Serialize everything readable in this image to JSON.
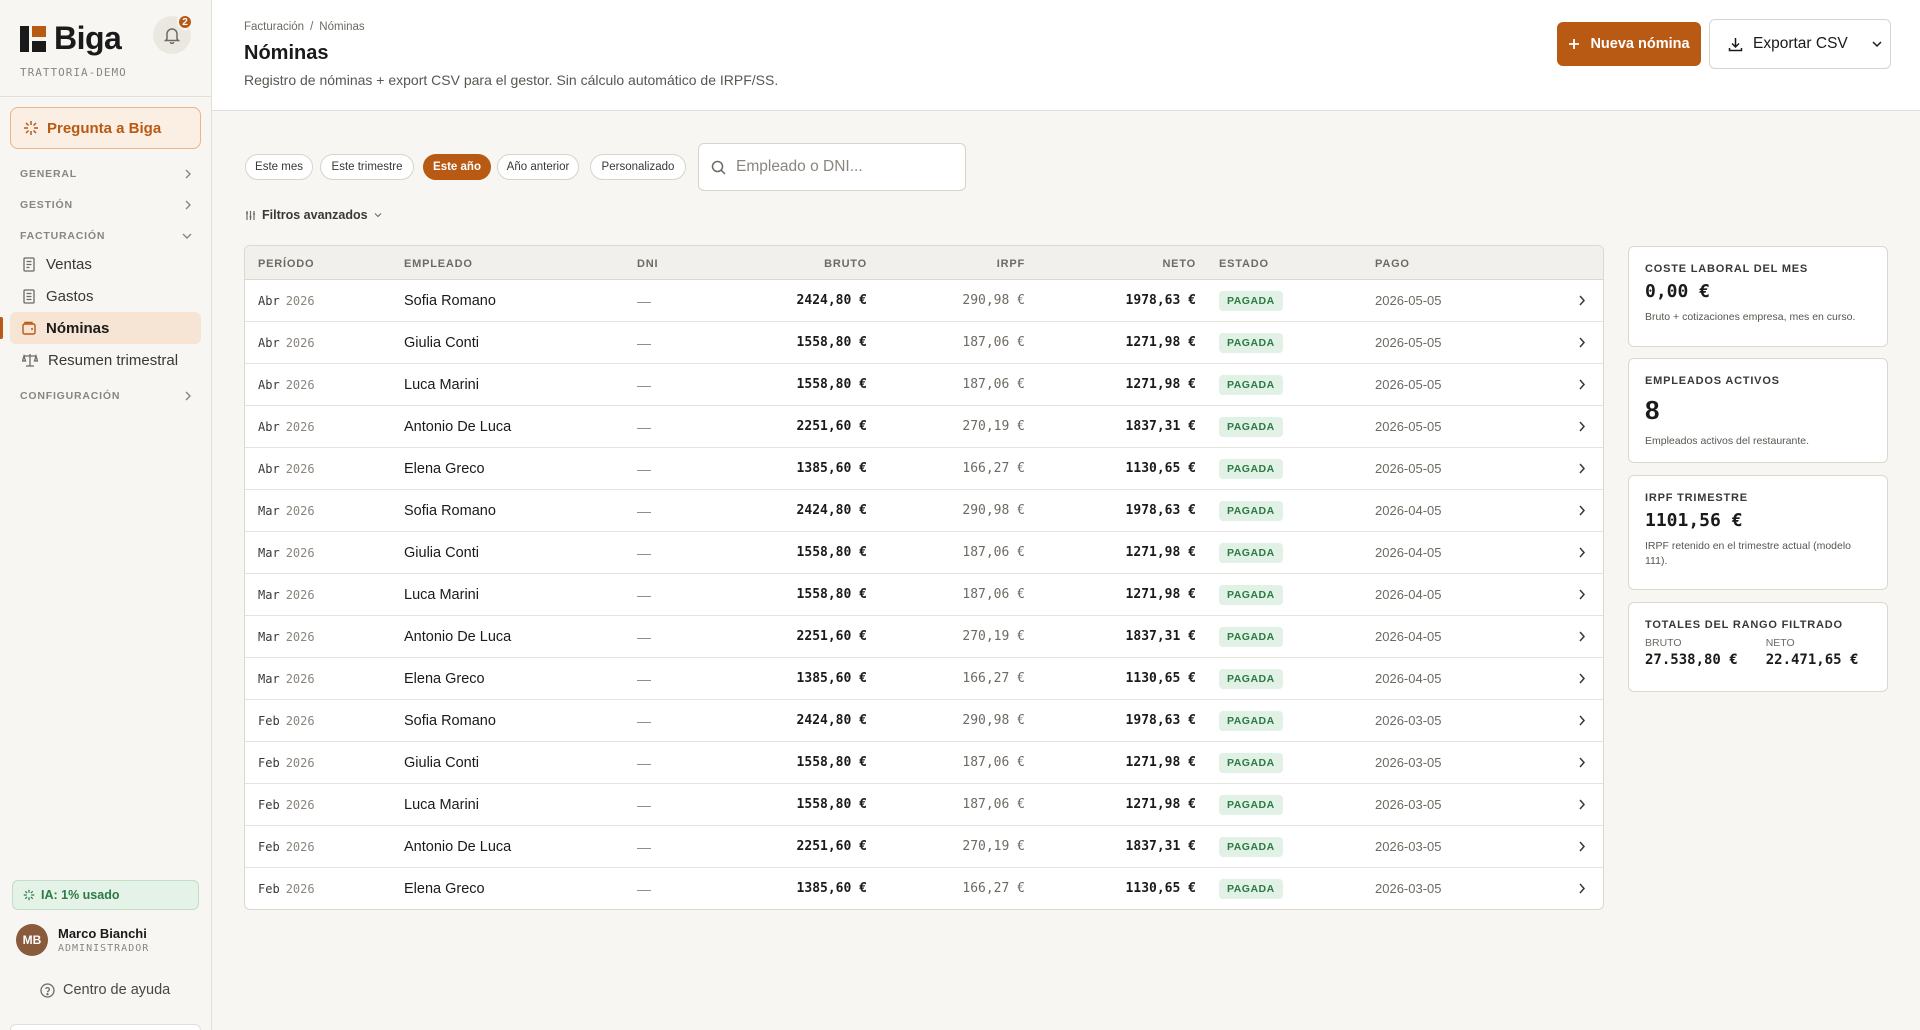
{
  "sidebar": {
    "brand": "Biga",
    "tenant": "TRATTORIA-DEMO",
    "notifications": "2",
    "ask_label": "Pregunta a Biga",
    "sections": {
      "general": "GENERAL",
      "gestion": "GESTIÓN",
      "facturacion": "FACTURACIÓN",
      "configuracion": "CONFIGURACIÓN"
    },
    "items": [
      {
        "label": "Ventas",
        "icon": "receipt-icon"
      },
      {
        "label": "Gastos",
        "icon": "document-icon"
      },
      {
        "label": "Nóminas",
        "icon": "wallet-icon",
        "active": true
      },
      {
        "label": "Resumen trimestral",
        "icon": "scale-icon"
      }
    ],
    "ia_usage": "IA: 1% usado",
    "user": {
      "initials": "MB",
      "name": "Marco Bianchi",
      "role": "ADMINISTRADOR"
    },
    "help": "Centro de ayuda"
  },
  "header": {
    "breadcrumb": [
      "Facturación",
      "Nóminas"
    ],
    "breadcrumb_sep": "/",
    "title": "Nóminas",
    "subtitle": "Registro de nóminas + export CSV para el gestor. Sin cálculo automático de IRPF/SS.",
    "new_button": "Nueva nómina",
    "export_button": "Exportar CSV"
  },
  "filters": {
    "chips": [
      "Este mes",
      "Este trimestre",
      "Este año",
      "Año anterior",
      "Personalizado"
    ],
    "active_chip": "Este año",
    "search_placeholder": "Empleado o DNI...",
    "advanced": "Filtros avanzados"
  },
  "table": {
    "columns": [
      "PERÍODO",
      "EMPLEADO",
      "DNI",
      "BRUTO",
      "IRPF",
      "NETO",
      "ESTADO",
      "PAGO"
    ],
    "rows": [
      {
        "mes": "Abr",
        "anio": "2026",
        "empleado": "Sofia Romano",
        "dni": "—",
        "bruto": "2424,80 €",
        "irpf": "290,98 €",
        "neto": "1978,63 €",
        "estado": "PAGADA",
        "pago": "2026-05-05"
      },
      {
        "mes": "Abr",
        "anio": "2026",
        "empleado": "Giulia Conti",
        "dni": "—",
        "bruto": "1558,80 €",
        "irpf": "187,06 €",
        "neto": "1271,98 €",
        "estado": "PAGADA",
        "pago": "2026-05-05"
      },
      {
        "mes": "Abr",
        "anio": "2026",
        "empleado": "Luca Marini",
        "dni": "—",
        "bruto": "1558,80 €",
        "irpf": "187,06 €",
        "neto": "1271,98 €",
        "estado": "PAGADA",
        "pago": "2026-05-05"
      },
      {
        "mes": "Abr",
        "anio": "2026",
        "empleado": "Antonio De Luca",
        "dni": "—",
        "bruto": "2251,60 €",
        "irpf": "270,19 €",
        "neto": "1837,31 €",
        "estado": "PAGADA",
        "pago": "2026-05-05"
      },
      {
        "mes": "Abr",
        "anio": "2026",
        "empleado": "Elena Greco",
        "dni": "—",
        "bruto": "1385,60 €",
        "irpf": "166,27 €",
        "neto": "1130,65 €",
        "estado": "PAGADA",
        "pago": "2026-05-05"
      },
      {
        "mes": "Mar",
        "anio": "2026",
        "empleado": "Sofia Romano",
        "dni": "—",
        "bruto": "2424,80 €",
        "irpf": "290,98 €",
        "neto": "1978,63 €",
        "estado": "PAGADA",
        "pago": "2026-04-05"
      },
      {
        "mes": "Mar",
        "anio": "2026",
        "empleado": "Giulia Conti",
        "dni": "—",
        "bruto": "1558,80 €",
        "irpf": "187,06 €",
        "neto": "1271,98 €",
        "estado": "PAGADA",
        "pago": "2026-04-05"
      },
      {
        "mes": "Mar",
        "anio": "2026",
        "empleado": "Luca Marini",
        "dni": "—",
        "bruto": "1558,80 €",
        "irpf": "187,06 €",
        "neto": "1271,98 €",
        "estado": "PAGADA",
        "pago": "2026-04-05"
      },
      {
        "mes": "Mar",
        "anio": "2026",
        "empleado": "Antonio De Luca",
        "dni": "—",
        "bruto": "2251,60 €",
        "irpf": "270,19 €",
        "neto": "1837,31 €",
        "estado": "PAGADA",
        "pago": "2026-04-05"
      },
      {
        "mes": "Mar",
        "anio": "2026",
        "empleado": "Elena Greco",
        "dni": "—",
        "bruto": "1385,60 €",
        "irpf": "166,27 €",
        "neto": "1130,65 €",
        "estado": "PAGADA",
        "pago": "2026-04-05"
      },
      {
        "mes": "Feb",
        "anio": "2026",
        "empleado": "Sofia Romano",
        "dni": "—",
        "bruto": "2424,80 €",
        "irpf": "290,98 €",
        "neto": "1978,63 €",
        "estado": "PAGADA",
        "pago": "2026-03-05"
      },
      {
        "mes": "Feb",
        "anio": "2026",
        "empleado": "Giulia Conti",
        "dni": "—",
        "bruto": "1558,80 €",
        "irpf": "187,06 €",
        "neto": "1271,98 €",
        "estado": "PAGADA",
        "pago": "2026-03-05"
      },
      {
        "mes": "Feb",
        "anio": "2026",
        "empleado": "Luca Marini",
        "dni": "—",
        "bruto": "1558,80 €",
        "irpf": "187,06 €",
        "neto": "1271,98 €",
        "estado": "PAGADA",
        "pago": "2026-03-05"
      },
      {
        "mes": "Feb",
        "anio": "2026",
        "empleado": "Antonio De Luca",
        "dni": "—",
        "bruto": "2251,60 €",
        "irpf": "270,19 €",
        "neto": "1837,31 €",
        "estado": "PAGADA",
        "pago": "2026-03-05"
      },
      {
        "mes": "Feb",
        "anio": "2026",
        "empleado": "Elena Greco",
        "dni": "—",
        "bruto": "1385,60 €",
        "irpf": "166,27 €",
        "neto": "1130,65 €",
        "estado": "PAGADA",
        "pago": "2026-03-05"
      }
    ]
  },
  "cards": {
    "coste": {
      "label": "COSTE LABORAL DEL MES",
      "value": "0,00 €",
      "note": "Bruto + cotizaciones empresa, mes en curso."
    },
    "empleados": {
      "label": "EMPLEADOS ACTIVOS",
      "value": "8",
      "note": "Empleados activos del restaurante."
    },
    "irpf": {
      "label": "IRPF TRIMESTRE",
      "value": "1101,56 €",
      "note": "IRPF retenido en el trimestre actual (modelo 111)."
    },
    "totales": {
      "label": "TOTALES DEL RANGO FILTRADO",
      "bruto_label": "BRUTO",
      "bruto": "27.538,80 €",
      "neto_label": "NETO",
      "neto": "22.471,65 €"
    }
  },
  "colors": {
    "accent": "#b85a14",
    "success": "#2c7a44",
    "success_bg": "#e1f1e5"
  }
}
